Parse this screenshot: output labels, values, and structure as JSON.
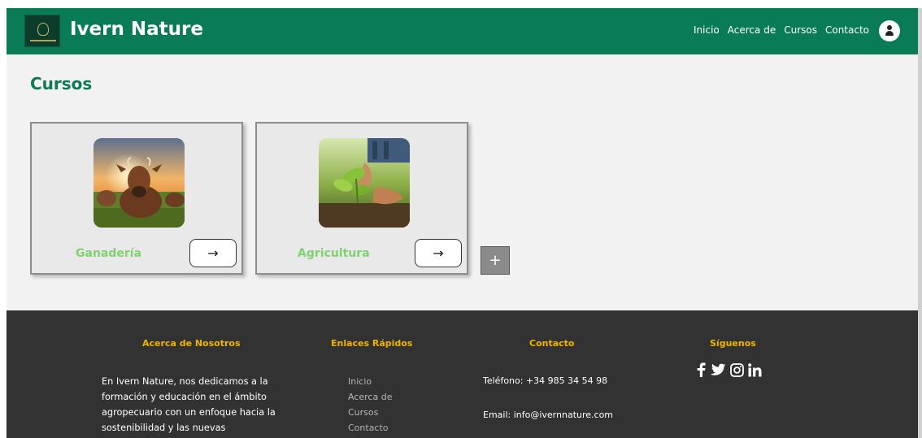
{
  "header": {
    "brand": "Ivern Nature",
    "nav": [
      "Inicio",
      "Acerca de",
      "Cursos",
      "Contacto"
    ]
  },
  "main": {
    "title": "Cursos",
    "cards": [
      {
        "label": "Ganadería",
        "image": "cow-pasture-photo",
        "arrow": "→"
      },
      {
        "label": "Agricultura",
        "image": "hands-planting-seedling-photo",
        "arrow": "→"
      }
    ],
    "add_label": "+"
  },
  "footer": {
    "about": {
      "heading": "Acerca de Nosotros",
      "text": "En Ivern Nature, nos dedicamos a la formación y educación en el ámbito agropecuario con un enfoque hacia la sostenibilidad y las nuevas"
    },
    "links": {
      "heading": "Enlaces Rápidos",
      "items": [
        "Inicio",
        "Acerca de",
        "Cursos",
        "Contacto"
      ]
    },
    "contact": {
      "heading": "Contacto",
      "phone": "Teléfono: +34 985 34 54 98",
      "email": "Email: info@ivernnature.com"
    },
    "social": {
      "heading": "Síguenos",
      "icons": [
        "facebook-icon",
        "twitter-icon",
        "instagram-icon",
        "linkedin-icon"
      ]
    }
  },
  "colors": {
    "header_bg": "#097b57",
    "title": "#0b7a55",
    "card_label": "#7ed36f",
    "footer_bg": "#323232",
    "footer_heading": "#f0b400"
  }
}
